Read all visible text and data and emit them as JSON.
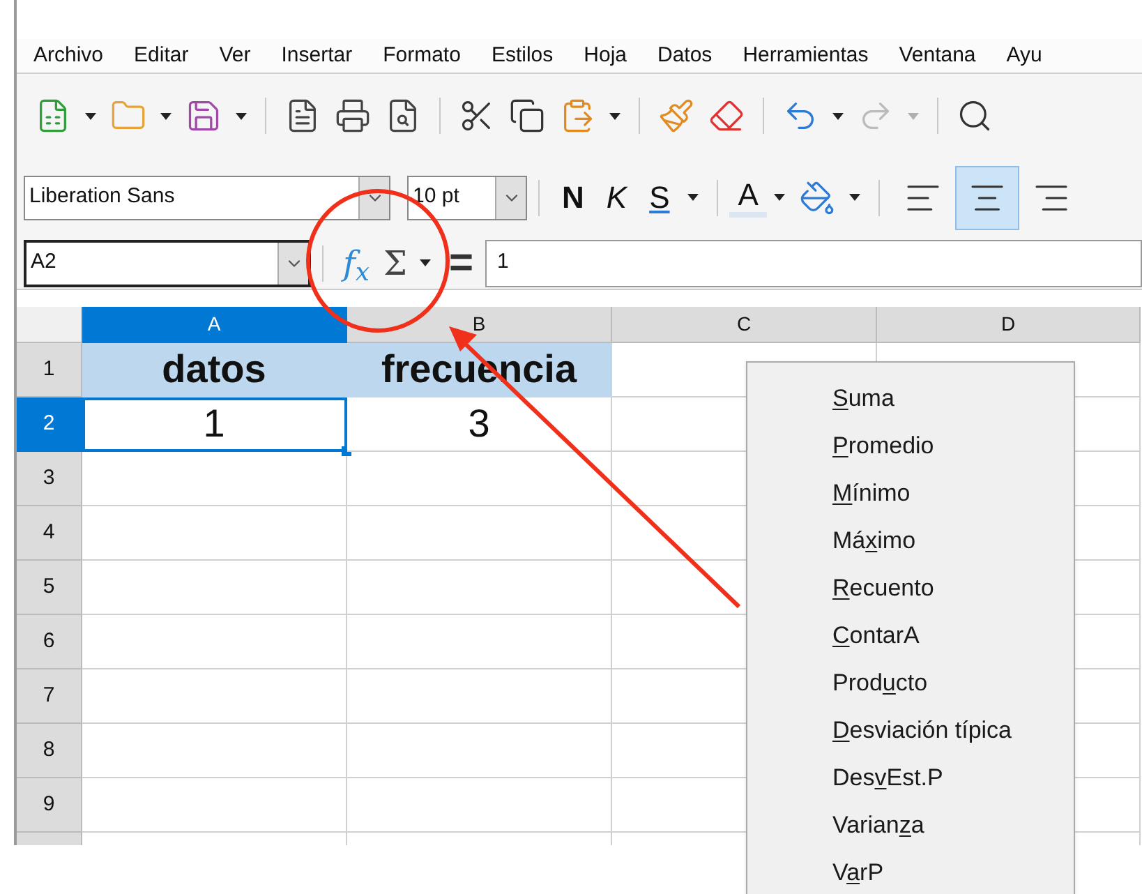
{
  "menu_bar": [
    "Archivo",
    "Editar",
    "Ver",
    "Insertar",
    "Formato",
    "Estilos",
    "Hoja",
    "Datos",
    "Herramientas",
    "Ventana",
    "Ayu"
  ],
  "formatting": {
    "font_name": "Liberation Sans",
    "font_size": "10 pt",
    "bold": "N",
    "italic": "K",
    "underline": "S",
    "font_color": "A",
    "align": [
      {
        "kind": "left",
        "selected": false
      },
      {
        "kind": "center",
        "selected": true
      },
      {
        "kind": "right",
        "selected": false
      }
    ]
  },
  "formula_bar": {
    "name_box": "A2",
    "function_wizard": "f$_{x}$",
    "sum": "Σ",
    "equals": "=",
    "value": "1"
  },
  "columns": [
    {
      "label": "A",
      "selected": true
    },
    {
      "label": "B",
      "selected": false
    },
    {
      "label": "C",
      "selected": false
    },
    {
      "label": "D",
      "selected": false
    }
  ],
  "rows": [
    {
      "label": "1",
      "selected": false,
      "cells": [
        {
          "text": "datos",
          "header": true
        },
        {
          "text": "frecuencia",
          "header": true
        }
      ]
    },
    {
      "label": "2",
      "selected": true,
      "cells": [
        {
          "text": "1",
          "header": false,
          "selected": true
        },
        {
          "text": "3",
          "header": false,
          "selected": false
        }
      ]
    },
    {
      "label": "3",
      "selected": false,
      "cells": []
    },
    {
      "label": "4",
      "selected": false,
      "cells": []
    },
    {
      "label": "5",
      "selected": false,
      "cells": []
    },
    {
      "label": "6",
      "selected": false,
      "cells": []
    },
    {
      "label": "7",
      "selected": false,
      "cells": []
    },
    {
      "label": "8",
      "selected": false,
      "cells": []
    },
    {
      "label": "9",
      "selected": false,
      "cells": []
    }
  ],
  "sum_menu": [
    {
      "access_key": "S",
      "after": "uma"
    },
    {
      "access_key": "P",
      "after": "romedio"
    },
    {
      "access_key": "M",
      "after": "ínimo"
    },
    {
      "before": "Má",
      "access_key": "x",
      "after": "imo"
    },
    {
      "access_key": "R",
      "after": "ecuento"
    },
    {
      "access_key": "C",
      "after": "ontarA"
    },
    {
      "before": "Prod",
      "access_key": "u",
      "after": "cto"
    },
    {
      "access_key": "D",
      "after": "esviación típica"
    },
    {
      "before": "Des",
      "access_key": "v",
      "after": "Est.P"
    },
    {
      "before": "Varian",
      "access_key": "z",
      "after": "a"
    },
    {
      "before": "V",
      "access_key": "a",
      "after": "rP"
    }
  ]
}
